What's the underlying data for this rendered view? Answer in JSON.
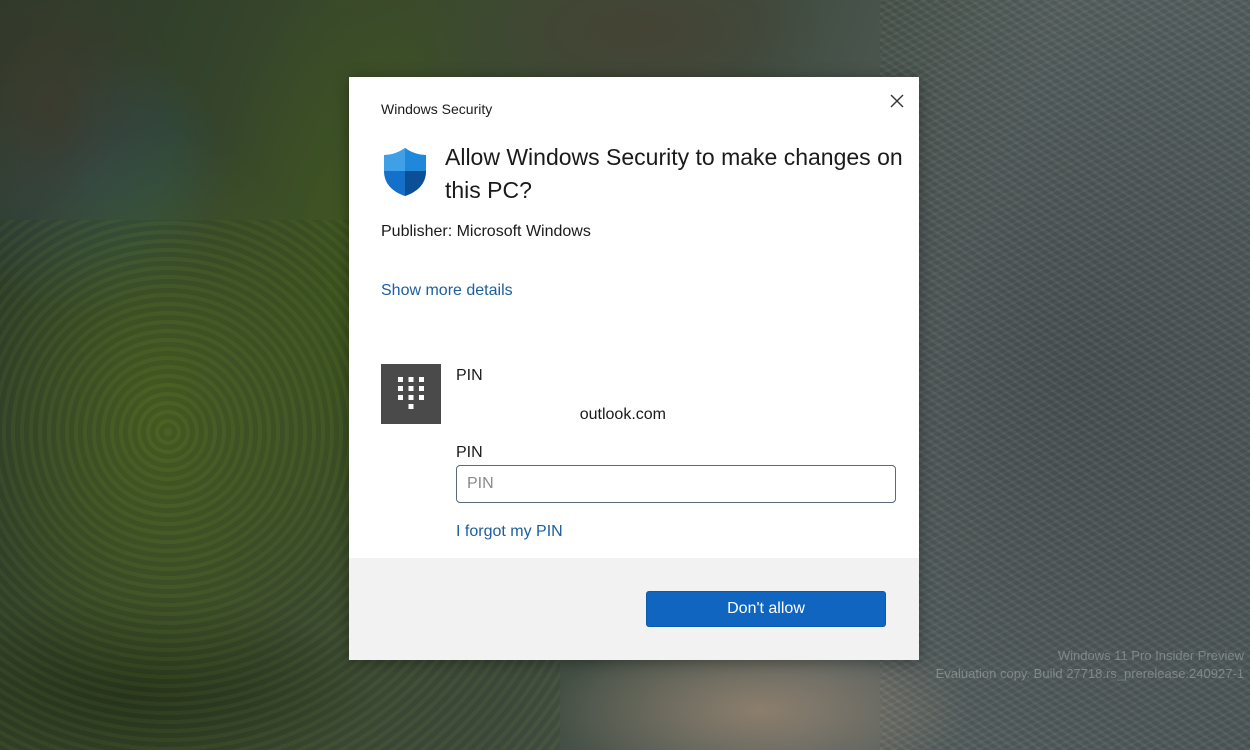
{
  "desktop": {
    "watermark_line1": "Windows 11 Pro Insider Preview",
    "watermark_line2": "Evaluation copy. Build 27718.rs_prerelease.240927-1"
  },
  "dialog": {
    "app_name": "Windows Security",
    "close_icon": "close-icon",
    "app_icon": "shield-icon",
    "title": "Allow Windows Security to make changes on this PC?",
    "publisher": "Publisher: Microsoft Windows",
    "details_link": "Show more details",
    "credential": {
      "icon": "pin-keypad-icon",
      "type": "PIN",
      "account": "outlook.com",
      "field_label": "PIN",
      "field_value": "",
      "field_placeholder": "PIN",
      "forgot_link": "I forgot my PIN"
    },
    "button_label": "Don't allow"
  },
  "colors": {
    "accent": "#0f65c0",
    "link": "#1b5e9e",
    "footer_bg": "#f2f2f2",
    "pin_tile": "#4a4a4a"
  }
}
